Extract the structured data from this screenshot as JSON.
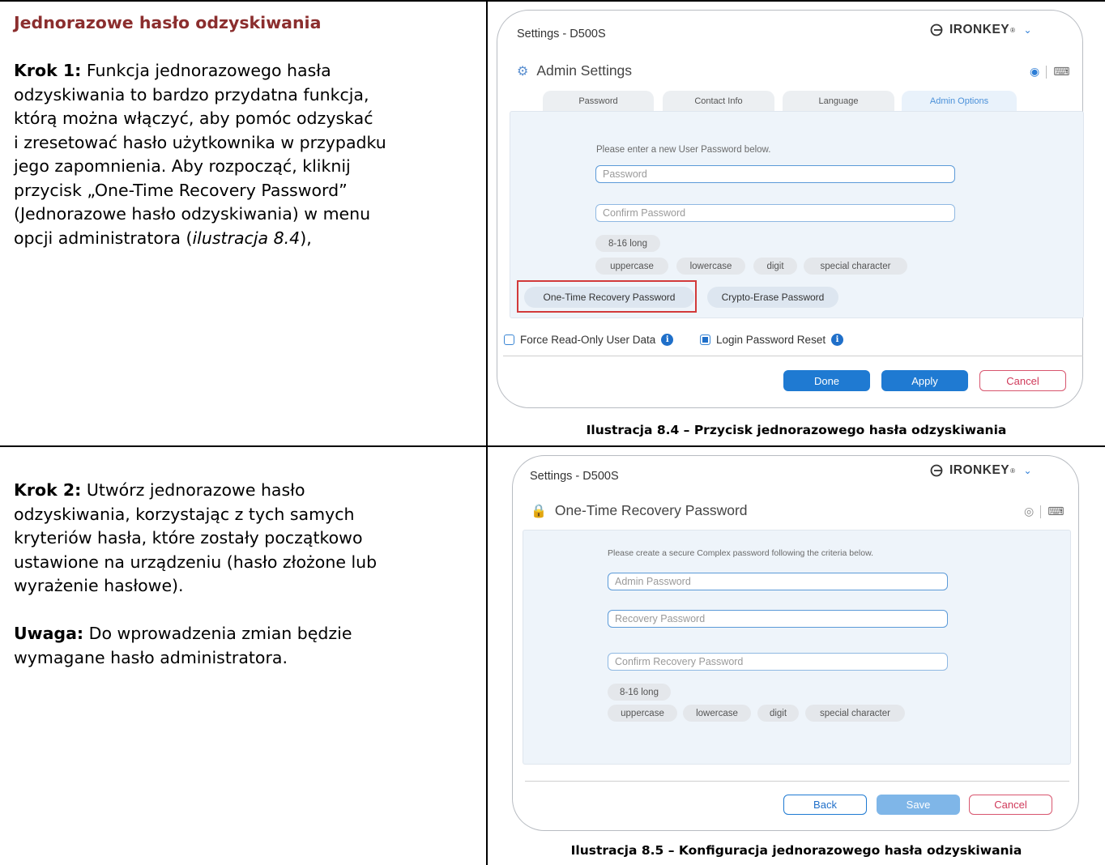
{
  "step1": {
    "heading": "Jednorazowe hasło odzyskiwania",
    "label": "Krok 1:",
    "lines": [
      "Funkcja jednorazowego hasła",
      "odzyskiwania to bardzo przydatna funkcja,",
      "którą można włączyć, aby pomóc odzyskać",
      "i zresetować hasło użytkownika w przypadku",
      "jego zapomnienia. Aby rozpocząć, kliknij",
      "przycisk „One-Time Recovery Password”",
      "(Jednorazowe hasło odzyskiwania) w menu"
    ],
    "last_line_prefix": "opcji administratora (",
    "last_line_italic": "ilustracja 8.4",
    "last_line_suffix": "),"
  },
  "step2": {
    "label": "Krok 2:",
    "lines": [
      "Utwórz jednorazowe hasło",
      "odzyskiwania, korzystając z tych samych",
      "kryteriów hasła, które zostały początkowo",
      "ustawione na urządzeniu (hasło złożone lub",
      "wyrażenie hasłowe)."
    ],
    "note_label": "Uwaga:",
    "note_lines": [
      "Do wprowadzenia zmian będzie",
      "wymagane hasło administratora."
    ]
  },
  "figure1": {
    "window_title": "Settings - D500S",
    "logo": "IRONKEY",
    "logo_mark": "®",
    "section_title": "Admin Settings",
    "tabs": [
      "Password",
      "Contact Info",
      "Language",
      "Admin Options"
    ],
    "hint": "Please enter a new User Password below.",
    "password_placeholder": "Password",
    "confirm_placeholder": "Confirm Password",
    "chip_length": "8-16 long",
    "chips": [
      "uppercase",
      "lowercase",
      "digit",
      "special character"
    ],
    "btn_recovery": "One-Time Recovery Password",
    "btn_crypto": "Crypto-Erase Password",
    "check_force": "Force Read-Only User Data",
    "check_reset": "Login Password Reset",
    "btn_done": "Done",
    "btn_apply": "Apply",
    "btn_cancel": "Cancel",
    "caption": "Ilustracja 8.4 – Przycisk jednorazowego hasła odzyskiwania"
  },
  "figure2": {
    "window_title": "Settings - D500S",
    "logo": "IRONKEY",
    "logo_mark": "®",
    "section_title": "One-Time Recovery Password",
    "hint": "Please create a secure Complex password following the criteria below.",
    "admin_placeholder": "Admin Password",
    "recovery_placeholder": "Recovery Password",
    "confirm_placeholder": "Confirm Recovery Password",
    "chip_length": "8-16 long",
    "chips": [
      "uppercase",
      "lowercase",
      "digit",
      "special character"
    ],
    "btn_back": "Back",
    "btn_save": "Save",
    "btn_cancel": "Cancel",
    "caption": "Ilustracja 8.5 – Konfiguracja jednorazowego hasła odzyskiwania"
  }
}
